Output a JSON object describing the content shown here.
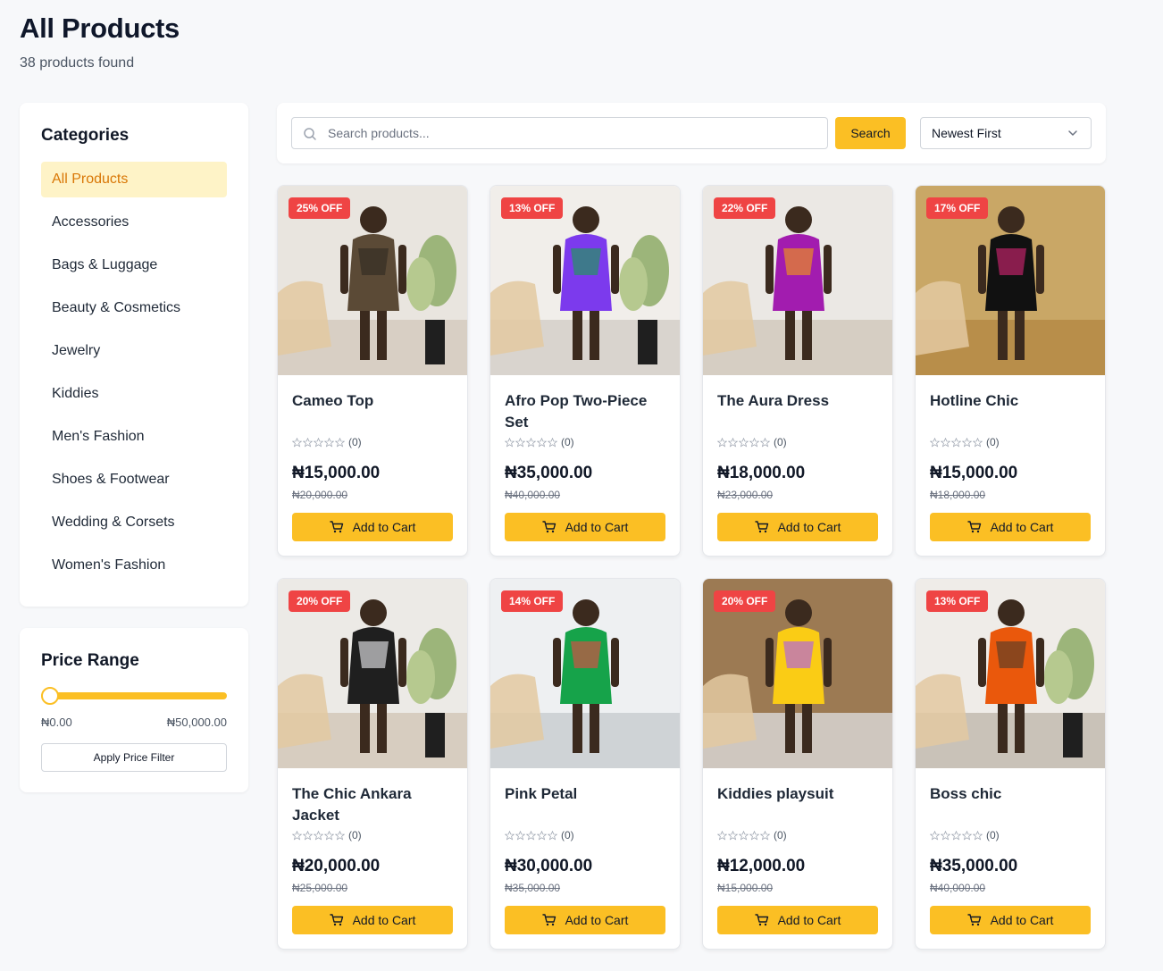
{
  "header": {
    "title": "All Products",
    "subtitle": "38 products found"
  },
  "categories": {
    "title": "Categories",
    "items": [
      {
        "label": "All Products",
        "active": true
      },
      {
        "label": "Accessories"
      },
      {
        "label": "Bags & Luggage"
      },
      {
        "label": "Beauty & Cosmetics"
      },
      {
        "label": "Jewelry"
      },
      {
        "label": "Kiddies"
      },
      {
        "label": "Men's Fashion"
      },
      {
        "label": "Shoes & Footwear"
      },
      {
        "label": "Wedding & Corsets"
      },
      {
        "label": "Women's Fashion"
      }
    ]
  },
  "price_range": {
    "title": "Price Range",
    "min_label": "₦0.00",
    "max_label": "₦50,000.00",
    "slider_value_fraction": 0,
    "apply_label": "Apply Price Filter"
  },
  "toolbar": {
    "search_placeholder": "Search products...",
    "search_value": "",
    "search_button": "Search",
    "sort_selected": "Newest First"
  },
  "colors": {
    "accent": "#fbbf24",
    "badge": "#ef4444",
    "active_bg": "#fef3c7",
    "active_text": "#d97706"
  },
  "products": [
    {
      "name": "Cameo Top",
      "badge": "25% OFF",
      "rating_count": "(0)",
      "price": "₦15,000.00",
      "old_price": "₦20,000.00",
      "add_label": "Add to Cart"
    },
    {
      "name": "Afro Pop Two-Piece Set",
      "badge": "13% OFF",
      "rating_count": "(0)",
      "price": "₦35,000.00",
      "old_price": "₦40,000.00",
      "add_label": "Add to Cart"
    },
    {
      "name": "The Aura Dress",
      "badge": "22% OFF",
      "rating_count": "(0)",
      "price": "₦18,000.00",
      "old_price": "₦23,000.00",
      "add_label": "Add to Cart"
    },
    {
      "name": "Hotline Chic",
      "badge": "17% OFF",
      "rating_count": "(0)",
      "price": "₦15,000.00",
      "old_price": "₦18,000.00",
      "add_label": "Add to Cart"
    },
    {
      "name": "The Chic Ankara Jacket",
      "badge": "20% OFF",
      "rating_count": "(0)",
      "price": "₦20,000.00",
      "old_price": "₦25,000.00",
      "add_label": "Add to Cart"
    },
    {
      "name": "Pink Petal",
      "badge": "14% OFF",
      "rating_count": "(0)",
      "price": "₦30,000.00",
      "old_price": "₦35,000.00",
      "add_label": "Add to Cart"
    },
    {
      "name": "Kiddies playsuit",
      "badge": "20% OFF",
      "rating_count": "(0)",
      "price": "₦12,000.00",
      "old_price": "₦15,000.00",
      "add_label": "Add to Cart"
    },
    {
      "name": "Boss chic",
      "badge": "13% OFF",
      "rating_count": "(0)",
      "price": "₦35,000.00",
      "old_price": "₦40,000.00",
      "add_label": "Add to Cart"
    }
  ]
}
